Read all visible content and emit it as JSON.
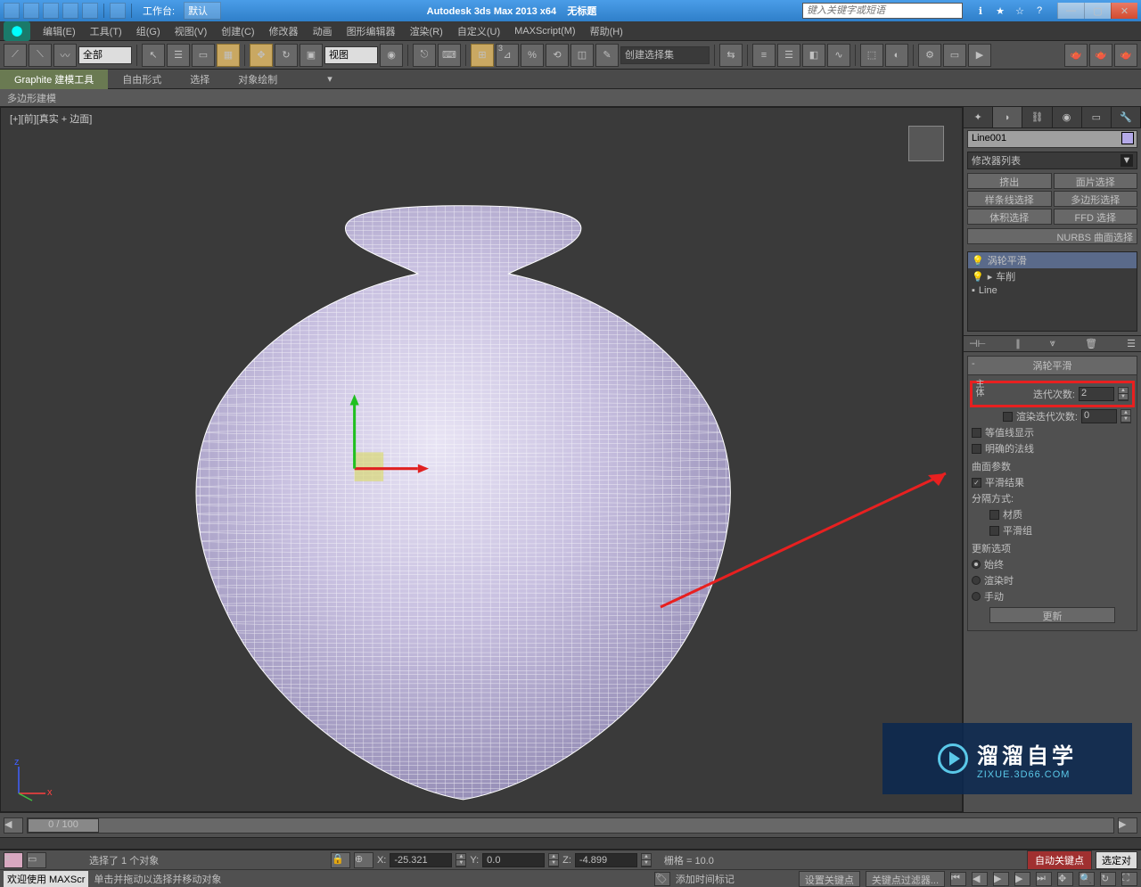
{
  "titlebar": {
    "workspace_label": "工作台:",
    "workspace_value": "默认",
    "app_title": "Autodesk 3ds Max  2013 x64",
    "doc_title": "无标题",
    "search_placeholder": "键入关键字或短语"
  },
  "menubar": {
    "items": [
      "编辑(E)",
      "工具(T)",
      "组(G)",
      "视图(V)",
      "创建(C)",
      "修改器",
      "动画",
      "图形编辑器",
      "渲染(R)",
      "自定义(U)",
      "MAXScript(M)",
      "帮助(H)"
    ]
  },
  "toolbar": {
    "sel_filter": "全部",
    "ref_coord": "视图",
    "named_set": "创建选择集"
  },
  "ribbon": {
    "tabs": [
      "Graphite 建模工具",
      "自由形式",
      "选择",
      "对象绘制"
    ],
    "sub": "多边形建模"
  },
  "viewport": {
    "label": "[+][前][真实 + 边面]"
  },
  "cmd_panel": {
    "obj_name": "Line001",
    "modifier_list_label": "修改器列表",
    "buttons": [
      "挤出",
      "面片选择",
      "样条线选择",
      "多边形选择",
      "体积选择",
      "FFD 选择"
    ],
    "nurbs_wrap": "NURBS 曲面选择",
    "stack": [
      "涡轮平滑",
      "车削",
      "Line"
    ],
    "side_label": "主体",
    "rollout_title": "涡轮平滑",
    "iterations_label": "迭代次数:",
    "iterations_value": "2",
    "render_iter_label": "渲染迭代次数:",
    "render_iter_value": "0",
    "isoline_label": "等值线显示",
    "explicit_label": "明确的法线",
    "surface_group": "曲面参数",
    "smooth_result": "平滑结果",
    "separate_by": "分隔方式:",
    "material": "材质",
    "smooth_group": "平滑组",
    "update_group": "更新选项",
    "update_always": "始终",
    "update_render": "渲染时",
    "update_manual": "手动",
    "update_btn": "更新"
  },
  "timeline": {
    "slider": "0 / 100"
  },
  "status": {
    "sel_info": "选择了 1 个对象",
    "x_label": "X:",
    "x_val": "-25.321",
    "y_label": "Y:",
    "y_val": "0.0",
    "z_label": "Z:",
    "z_val": "-4.899",
    "grid": "栅格 = 10.0",
    "auto_key": "自动关键点",
    "sel_obj": "选定对",
    "welcome": "欢迎使用  MAXScr",
    "prompt": "单击并拖动以选择并移动对象",
    "set_key": "设置关键点",
    "add_time_tag": "添加时间标记",
    "key_filter": "关键点过滤器..."
  },
  "watermark": {
    "title": "溜溜自学",
    "url": "ZIXUE.3D66.COM"
  }
}
